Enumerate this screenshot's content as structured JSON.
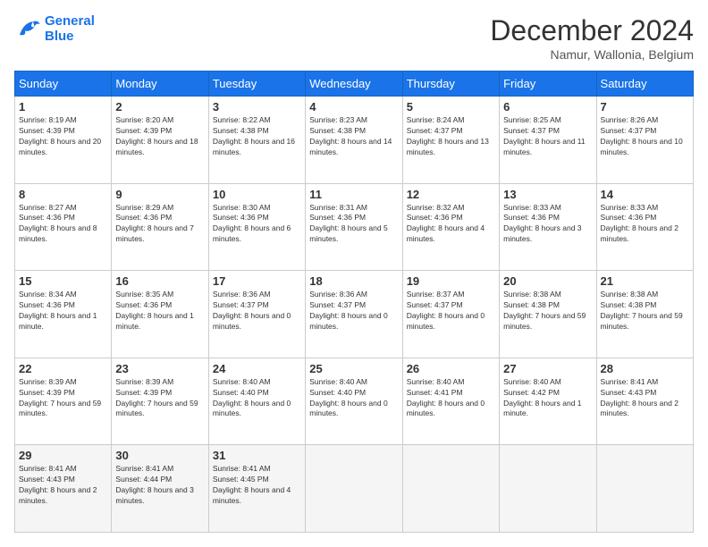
{
  "header": {
    "logo_line1": "General",
    "logo_line2": "Blue",
    "month_title": "December 2024",
    "location": "Namur, Wallonia, Belgium"
  },
  "weekdays": [
    "Sunday",
    "Monday",
    "Tuesday",
    "Wednesday",
    "Thursday",
    "Friday",
    "Saturday"
  ],
  "weeks": [
    [
      {
        "day": "1",
        "sunrise": "8:19 AM",
        "sunset": "4:39 PM",
        "daylight": "8 hours and 20 minutes."
      },
      {
        "day": "2",
        "sunrise": "8:20 AM",
        "sunset": "4:39 PM",
        "daylight": "8 hours and 18 minutes."
      },
      {
        "day": "3",
        "sunrise": "8:22 AM",
        "sunset": "4:38 PM",
        "daylight": "8 hours and 16 minutes."
      },
      {
        "day": "4",
        "sunrise": "8:23 AM",
        "sunset": "4:38 PM",
        "daylight": "8 hours and 14 minutes."
      },
      {
        "day": "5",
        "sunrise": "8:24 AM",
        "sunset": "4:37 PM",
        "daylight": "8 hours and 13 minutes."
      },
      {
        "day": "6",
        "sunrise": "8:25 AM",
        "sunset": "4:37 PM",
        "daylight": "8 hours and 11 minutes."
      },
      {
        "day": "7",
        "sunrise": "8:26 AM",
        "sunset": "4:37 PM",
        "daylight": "8 hours and 10 minutes."
      }
    ],
    [
      {
        "day": "8",
        "sunrise": "8:27 AM",
        "sunset": "4:36 PM",
        "daylight": "8 hours and 8 minutes."
      },
      {
        "day": "9",
        "sunrise": "8:29 AM",
        "sunset": "4:36 PM",
        "daylight": "8 hours and 7 minutes."
      },
      {
        "day": "10",
        "sunrise": "8:30 AM",
        "sunset": "4:36 PM",
        "daylight": "8 hours and 6 minutes."
      },
      {
        "day": "11",
        "sunrise": "8:31 AM",
        "sunset": "4:36 PM",
        "daylight": "8 hours and 5 minutes."
      },
      {
        "day": "12",
        "sunrise": "8:32 AM",
        "sunset": "4:36 PM",
        "daylight": "8 hours and 4 minutes."
      },
      {
        "day": "13",
        "sunrise": "8:33 AM",
        "sunset": "4:36 PM",
        "daylight": "8 hours and 3 minutes."
      },
      {
        "day": "14",
        "sunrise": "8:33 AM",
        "sunset": "4:36 PM",
        "daylight": "8 hours and 2 minutes."
      }
    ],
    [
      {
        "day": "15",
        "sunrise": "8:34 AM",
        "sunset": "4:36 PM",
        "daylight": "8 hours and 1 minute."
      },
      {
        "day": "16",
        "sunrise": "8:35 AM",
        "sunset": "4:36 PM",
        "daylight": "8 hours and 1 minute."
      },
      {
        "day": "17",
        "sunrise": "8:36 AM",
        "sunset": "4:37 PM",
        "daylight": "8 hours and 0 minutes."
      },
      {
        "day": "18",
        "sunrise": "8:36 AM",
        "sunset": "4:37 PM",
        "daylight": "8 hours and 0 minutes."
      },
      {
        "day": "19",
        "sunrise": "8:37 AM",
        "sunset": "4:37 PM",
        "daylight": "8 hours and 0 minutes."
      },
      {
        "day": "20",
        "sunrise": "8:38 AM",
        "sunset": "4:38 PM",
        "daylight": "7 hours and 59 minutes."
      },
      {
        "day": "21",
        "sunrise": "8:38 AM",
        "sunset": "4:38 PM",
        "daylight": "7 hours and 59 minutes."
      }
    ],
    [
      {
        "day": "22",
        "sunrise": "8:39 AM",
        "sunset": "4:39 PM",
        "daylight": "7 hours and 59 minutes."
      },
      {
        "day": "23",
        "sunrise": "8:39 AM",
        "sunset": "4:39 PM",
        "daylight": "7 hours and 59 minutes."
      },
      {
        "day": "24",
        "sunrise": "8:40 AM",
        "sunset": "4:40 PM",
        "daylight": "8 hours and 0 minutes."
      },
      {
        "day": "25",
        "sunrise": "8:40 AM",
        "sunset": "4:40 PM",
        "daylight": "8 hours and 0 minutes."
      },
      {
        "day": "26",
        "sunrise": "8:40 AM",
        "sunset": "4:41 PM",
        "daylight": "8 hours and 0 minutes."
      },
      {
        "day": "27",
        "sunrise": "8:40 AM",
        "sunset": "4:42 PM",
        "daylight": "8 hours and 1 minute."
      },
      {
        "day": "28",
        "sunrise": "8:41 AM",
        "sunset": "4:43 PM",
        "daylight": "8 hours and 2 minutes."
      }
    ],
    [
      {
        "day": "29",
        "sunrise": "8:41 AM",
        "sunset": "4:43 PM",
        "daylight": "8 hours and 2 minutes."
      },
      {
        "day": "30",
        "sunrise": "8:41 AM",
        "sunset": "4:44 PM",
        "daylight": "8 hours and 3 minutes."
      },
      {
        "day": "31",
        "sunrise": "8:41 AM",
        "sunset": "4:45 PM",
        "daylight": "8 hours and 4 minutes."
      },
      null,
      null,
      null,
      null
    ]
  ]
}
